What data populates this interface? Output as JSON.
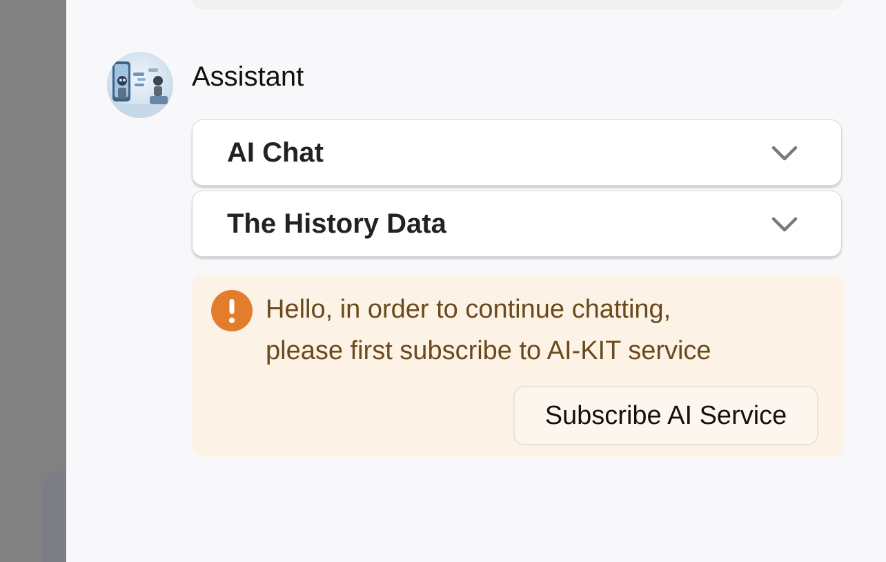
{
  "message": {
    "sender": "Assistant",
    "avatar_icon": "robot-chat-illustration-icon"
  },
  "accordions": [
    {
      "title": "AI Chat",
      "expanded": false,
      "icon": "chevron-down-icon"
    },
    {
      "title": "The History Data",
      "expanded": false,
      "icon": "chevron-down-icon"
    }
  ],
  "notice": {
    "icon": "warning-icon",
    "lines": [
      "Hello, in order to continue chatting,",
      "please first subscribe to AI-KIT service"
    ],
    "button_label": "Subscribe AI Service"
  },
  "colors": {
    "notice_bg": "#fcf2e6",
    "notice_text": "#6a4a1c",
    "warning_icon": "#e27d2e",
    "panel_bg": "#f8f8fa",
    "overlay": "#818181"
  }
}
